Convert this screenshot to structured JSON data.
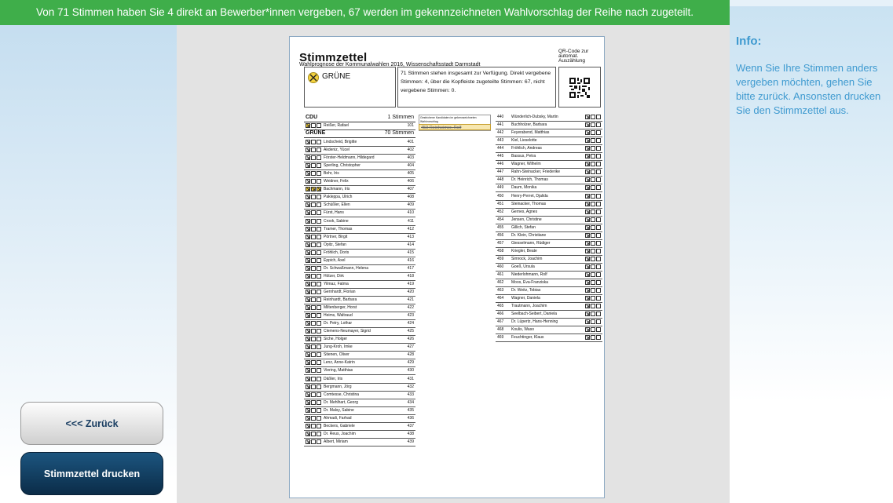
{
  "banner": {
    "text": "Von 71 Stimmen haben Sie 4 direkt an Bewerber*innen vergeben, 67 werden im gekennzeichneten Wahlvorschlag der Reihe nach zugeteilt."
  },
  "info": {
    "title": "Info:",
    "text": "Wenn Sie Ihre Stimmen anders vergeben möchten, gehen Sie bitte zurück. Ansonsten drucken Sie den Stimmzettel aus."
  },
  "buttons": {
    "back": "<<< Zurück",
    "print": "Stimmzettel drucken"
  },
  "ballot": {
    "title": "Stimmzettel",
    "subtitle": "Wahlprognose der Kommunalwahlen 2016, Wissenschaftsstadt Darmstadt",
    "qr_label": "QR-Code zur automat. Auszählung",
    "party": "GRÜNE",
    "summary": "71 Stimmen stehen insgesamt zur Verfügung. Direkt vergebene Stimmen: 4, über die Kopfleiste zugeteilte Stimmen: 67, nicht vergebene Stimmen: 0.",
    "crossed_note": "Gestrichene Kandidaten im gekennzeichneten Wahlvorschlag",
    "crossed_candidate": "459 Reinheimer, Rolf",
    "groups": [
      {
        "party": "CDU",
        "votes": "1 Stimmen"
      },
      {
        "party": "GRÜNE",
        "votes": "70 Stimmen"
      }
    ],
    "cdu_rows": [
      {
        "name": "Reißer, Rafael",
        "num": "101",
        "marks": "y--"
      }
    ],
    "left_rows": [
      {
        "name": "Lindscheid, Brigitte",
        "num": "401",
        "marks": "x--"
      },
      {
        "name": "Akdeniz, Yücel",
        "num": "402",
        "marks": "x--"
      },
      {
        "name": "Förster-Heldmann, Hildegard",
        "num": "403",
        "marks": "x--"
      },
      {
        "name": "Sperling, Christopher",
        "num": "404",
        "marks": "x--"
      },
      {
        "name": "Behr, Iris",
        "num": "405",
        "marks": "x--"
      },
      {
        "name": "Weidner, Felix",
        "num": "406",
        "marks": "x--"
      },
      {
        "name": "Bachmann, Iris",
        "num": "407",
        "marks": "yyy"
      },
      {
        "name": "Pakleppa, Ulrich",
        "num": "408",
        "marks": "x--"
      },
      {
        "name": "Schüßler, Ellen",
        "num": "409",
        "marks": "x--"
      },
      {
        "name": "Fürst, Hans",
        "num": "410",
        "marks": "x--"
      },
      {
        "name": "Crook, Sabine",
        "num": "411",
        "marks": "x--"
      },
      {
        "name": "Tramer, Thomas",
        "num": "412",
        "marks": "x--"
      },
      {
        "name": "Pörtner, Birgit",
        "num": "413",
        "marks": "x--"
      },
      {
        "name": "Opitz, Stefan",
        "num": "414",
        "marks": "x--"
      },
      {
        "name": "Fröhlich, Doris",
        "num": "415",
        "marks": "x--"
      },
      {
        "name": "Eppich, Axel",
        "num": "416",
        "marks": "x--"
      },
      {
        "name": "Dr. Schwaßmann, Helena",
        "num": "417",
        "marks": "x--"
      },
      {
        "name": "Hölzer, Dirk",
        "num": "418",
        "marks": "x--"
      },
      {
        "name": "Yilmaz, Fatma",
        "num": "419",
        "marks": "x--"
      },
      {
        "name": "Gernhardt, Florian",
        "num": "420",
        "marks": "x--"
      },
      {
        "name": "Reinhardt, Barbara",
        "num": "421",
        "marks": "x--"
      },
      {
        "name": "Miltenberger, Horst",
        "num": "422",
        "marks": "x--"
      },
      {
        "name": "Heims, Waltraud",
        "num": "423",
        "marks": "x--"
      },
      {
        "name": "Dr. Petry, Lothar",
        "num": "424",
        "marks": "x--"
      },
      {
        "name": "Clemens-Neumayer, Sigrid",
        "num": "425",
        "marks": "x--"
      },
      {
        "name": "Siche, Holger",
        "num": "426",
        "marks": "x--"
      },
      {
        "name": "Jung-Kroh, Imke",
        "num": "427",
        "marks": "x--"
      },
      {
        "name": "Stienen, Oliver",
        "num": "428",
        "marks": "x--"
      },
      {
        "name": "Lenz, Anne-Katrin",
        "num": "429",
        "marks": "x--"
      },
      {
        "name": "Viering, Matthias",
        "num": "430",
        "marks": "x--"
      },
      {
        "name": "Däßler, Iris",
        "num": "431",
        "marks": "x--"
      },
      {
        "name": "Bergmann, Jörg",
        "num": "432",
        "marks": "x--"
      },
      {
        "name": "Comtesse, Christina",
        "num": "433",
        "marks": "x--"
      },
      {
        "name": "Dr. Mehlhart, Georg",
        "num": "434",
        "marks": "x--"
      },
      {
        "name": "Dr. Malsy, Sabine",
        "num": "435",
        "marks": "x--"
      },
      {
        "name": "Ahmadi, Farhad",
        "num": "436",
        "marks": "x--"
      },
      {
        "name": "Beckers, Gabriele",
        "num": "437",
        "marks": "x--"
      },
      {
        "name": "Dr. Reus, Joachim",
        "num": "438",
        "marks": "x--"
      },
      {
        "name": "Albert, Miriam",
        "num": "439",
        "marks": "x--"
      }
    ],
    "right_rows": [
      {
        "name": "Wünderlich-Dubsky, Martin",
        "num": "440",
        "marks": "x--"
      },
      {
        "name": "Buchholzer, Barbara",
        "num": "441",
        "marks": "x--"
      },
      {
        "name": "Feyerabend, Matthias",
        "num": "442",
        "marks": "x--"
      },
      {
        "name": "Kiel, Lieselotte",
        "num": "443",
        "marks": "x--"
      },
      {
        "name": "Fröhlich, Andreas",
        "num": "444",
        "marks": "x--"
      },
      {
        "name": "Bassus, Petra",
        "num": "445",
        "marks": "x--"
      },
      {
        "name": "Wagner, Wilhelm",
        "num": "446",
        "marks": "x--"
      },
      {
        "name": "Rahn-Steinacker, Friederike",
        "num": "447",
        "marks": "x--"
      },
      {
        "name": "Dr. Heinrich, Thomas",
        "num": "448",
        "marks": "x--"
      },
      {
        "name": "Daum, Monika",
        "num": "449",
        "marks": "x--"
      },
      {
        "name": "Henry-Perret, Djalida",
        "num": "450",
        "marks": "x--"
      },
      {
        "name": "Steinacker, Thomas",
        "num": "451",
        "marks": "x--"
      },
      {
        "name": "Gernes, Agnes",
        "num": "452",
        "marks": "x--"
      },
      {
        "name": "Jensen, Christine",
        "num": "454",
        "marks": "x--"
      },
      {
        "name": "Gillich, Stefan",
        "num": "455",
        "marks": "x--"
      },
      {
        "name": "Dr. Klein, Christiane",
        "num": "456",
        "marks": "x--"
      },
      {
        "name": "Giesselmann, Rüdiger",
        "num": "457",
        "marks": "x--"
      },
      {
        "name": "Kriegler, Beate",
        "num": "458",
        "marks": "x--"
      },
      {
        "name": "Simrock, Joachim",
        "num": "459",
        "marks": "x--"
      },
      {
        "name": "Goeß, Ursula",
        "num": "460",
        "marks": "x--"
      },
      {
        "name": "Niederlohmann, Rolf",
        "num": "461",
        "marks": "x--"
      },
      {
        "name": "Moos, Eva-Franziska",
        "num": "462",
        "marks": "x--"
      },
      {
        "name": "Dr. Weitz, Tobias",
        "num": "463",
        "marks": "x--"
      },
      {
        "name": "Wagner, Daniela",
        "num": "464",
        "marks": "x--"
      },
      {
        "name": "Trautmann, Joachim",
        "num": "465",
        "marks": "x--"
      },
      {
        "name": "Seelbach-Seibert, Daniela",
        "num": "466",
        "marks": "x--"
      },
      {
        "name": "Dr. Lüpertz, Hans-Henning",
        "num": "467",
        "marks": "x--"
      },
      {
        "name": "Koulis, Waso",
        "num": "468",
        "marks": "x--"
      },
      {
        "name": "Feuchtinger, Klaus",
        "num": "469",
        "marks": "x--"
      }
    ]
  }
}
